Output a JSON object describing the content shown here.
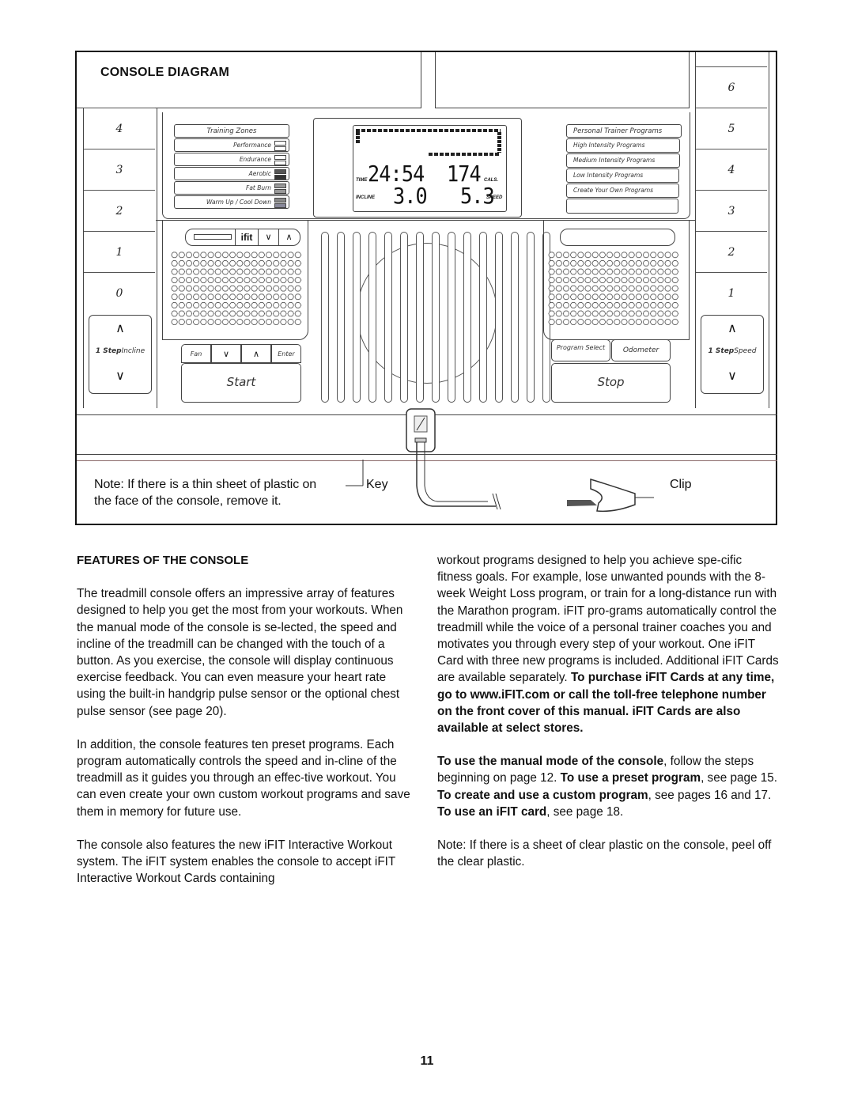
{
  "diagram": {
    "title": "CONSOLE DIAGRAM",
    "incline_keys": [
      "4",
      "3",
      "2",
      "1",
      "0"
    ],
    "incline_label_bold": "1 Step",
    "incline_label": "Incline",
    "speed_keys": [
      "6",
      "5",
      "4",
      "3",
      "2",
      "1"
    ],
    "speed_label_bold": "1 Step",
    "speed_label": "Speed",
    "training_zones": {
      "title": "Training Zones",
      "items": [
        "Performance",
        "Endurance",
        "Aerobic",
        "Fat Burn",
        "Warm Up / Cool Down"
      ]
    },
    "display": {
      "time": "24:54",
      "time_label": "TIME",
      "calories": "174",
      "calories_label": "CALS.",
      "incline": "3.0",
      "incline_label": "INCLINE",
      "speed": "5.3",
      "speed_label": "SPEED"
    },
    "trainer_programs": {
      "title": "Personal Trainer Programs",
      "items": [
        "High Intensity Programs",
        "Medium Intensity Programs",
        "Low Intensity Programs",
        "Create Your Own Programs",
        ""
      ]
    },
    "ifit_label": "ifit",
    "left_buttons": [
      "Fan",
      "∨",
      "∧",
      "Enter"
    ],
    "start_label": "Start",
    "right_buttons": [
      "Program Select",
      "Odometer"
    ],
    "stop_label": "Stop",
    "note": "Note: If there is a thin sheet of plastic on the face of the console, remove it.",
    "key_label": "Key",
    "clip_label": "Clip"
  },
  "features": {
    "heading": "FEATURES OF THE CONSOLE",
    "left_paragraphs": [
      "The treadmill console offers an impressive array of features designed to help you get the most from your workouts. When the manual mode of the console is se-lected, the speed and incline of the treadmill can be changed with the touch of a button. As you exercise, the console will display continuous exercise feedback. You can even measure your heart rate using the built-in handgrip pulse sensor or the optional chest pulse sensor (see page 20).",
      "In addition, the console features ten preset programs. Each program automatically controls the speed and in-cline of the treadmill as it guides you through an effec-tive workout. You can even create your own custom workout programs and save them in memory for future use.",
      "The console also features the new iFIT Interactive Workout system. The iFIT system enables the console to accept iFIT Interactive Workout Cards containing"
    ],
    "right_p1_normal": "workout programs designed to help you achieve spe-cific fitness goals. For example, lose unwanted pounds with the 8-week Weight Loss program, or train for a long-distance run with the Marathon program. iFIT pro-grams automatically control the treadmill while the voice of a personal trainer coaches you and motivates you through every step of your workout. One iFIT Card with three new programs is included. Additional iFIT Cards are available separately. ",
    "right_p1_bold": "To purchase iFIT Cards at any time, go to www.iFIT.com or call the toll-free telephone number on the front cover of this manual. iFIT Cards are also available at select stores.",
    "right_p2": [
      {
        "b": "To use the manual mode of the console"
      },
      {
        "t": ", follow the steps beginning on page 12. "
      },
      {
        "b": "To use a preset program"
      },
      {
        "t": ", see page 15. "
      },
      {
        "b": "To create and use a custom program"
      },
      {
        "t": ", see pages 16 and 17. "
      },
      {
        "b": "To use an iFIT card"
      },
      {
        "t": ", see page 18."
      }
    ],
    "right_p3": "Note: If there is a sheet of clear plastic on the console, peel off the clear plastic."
  },
  "page_number": "11"
}
